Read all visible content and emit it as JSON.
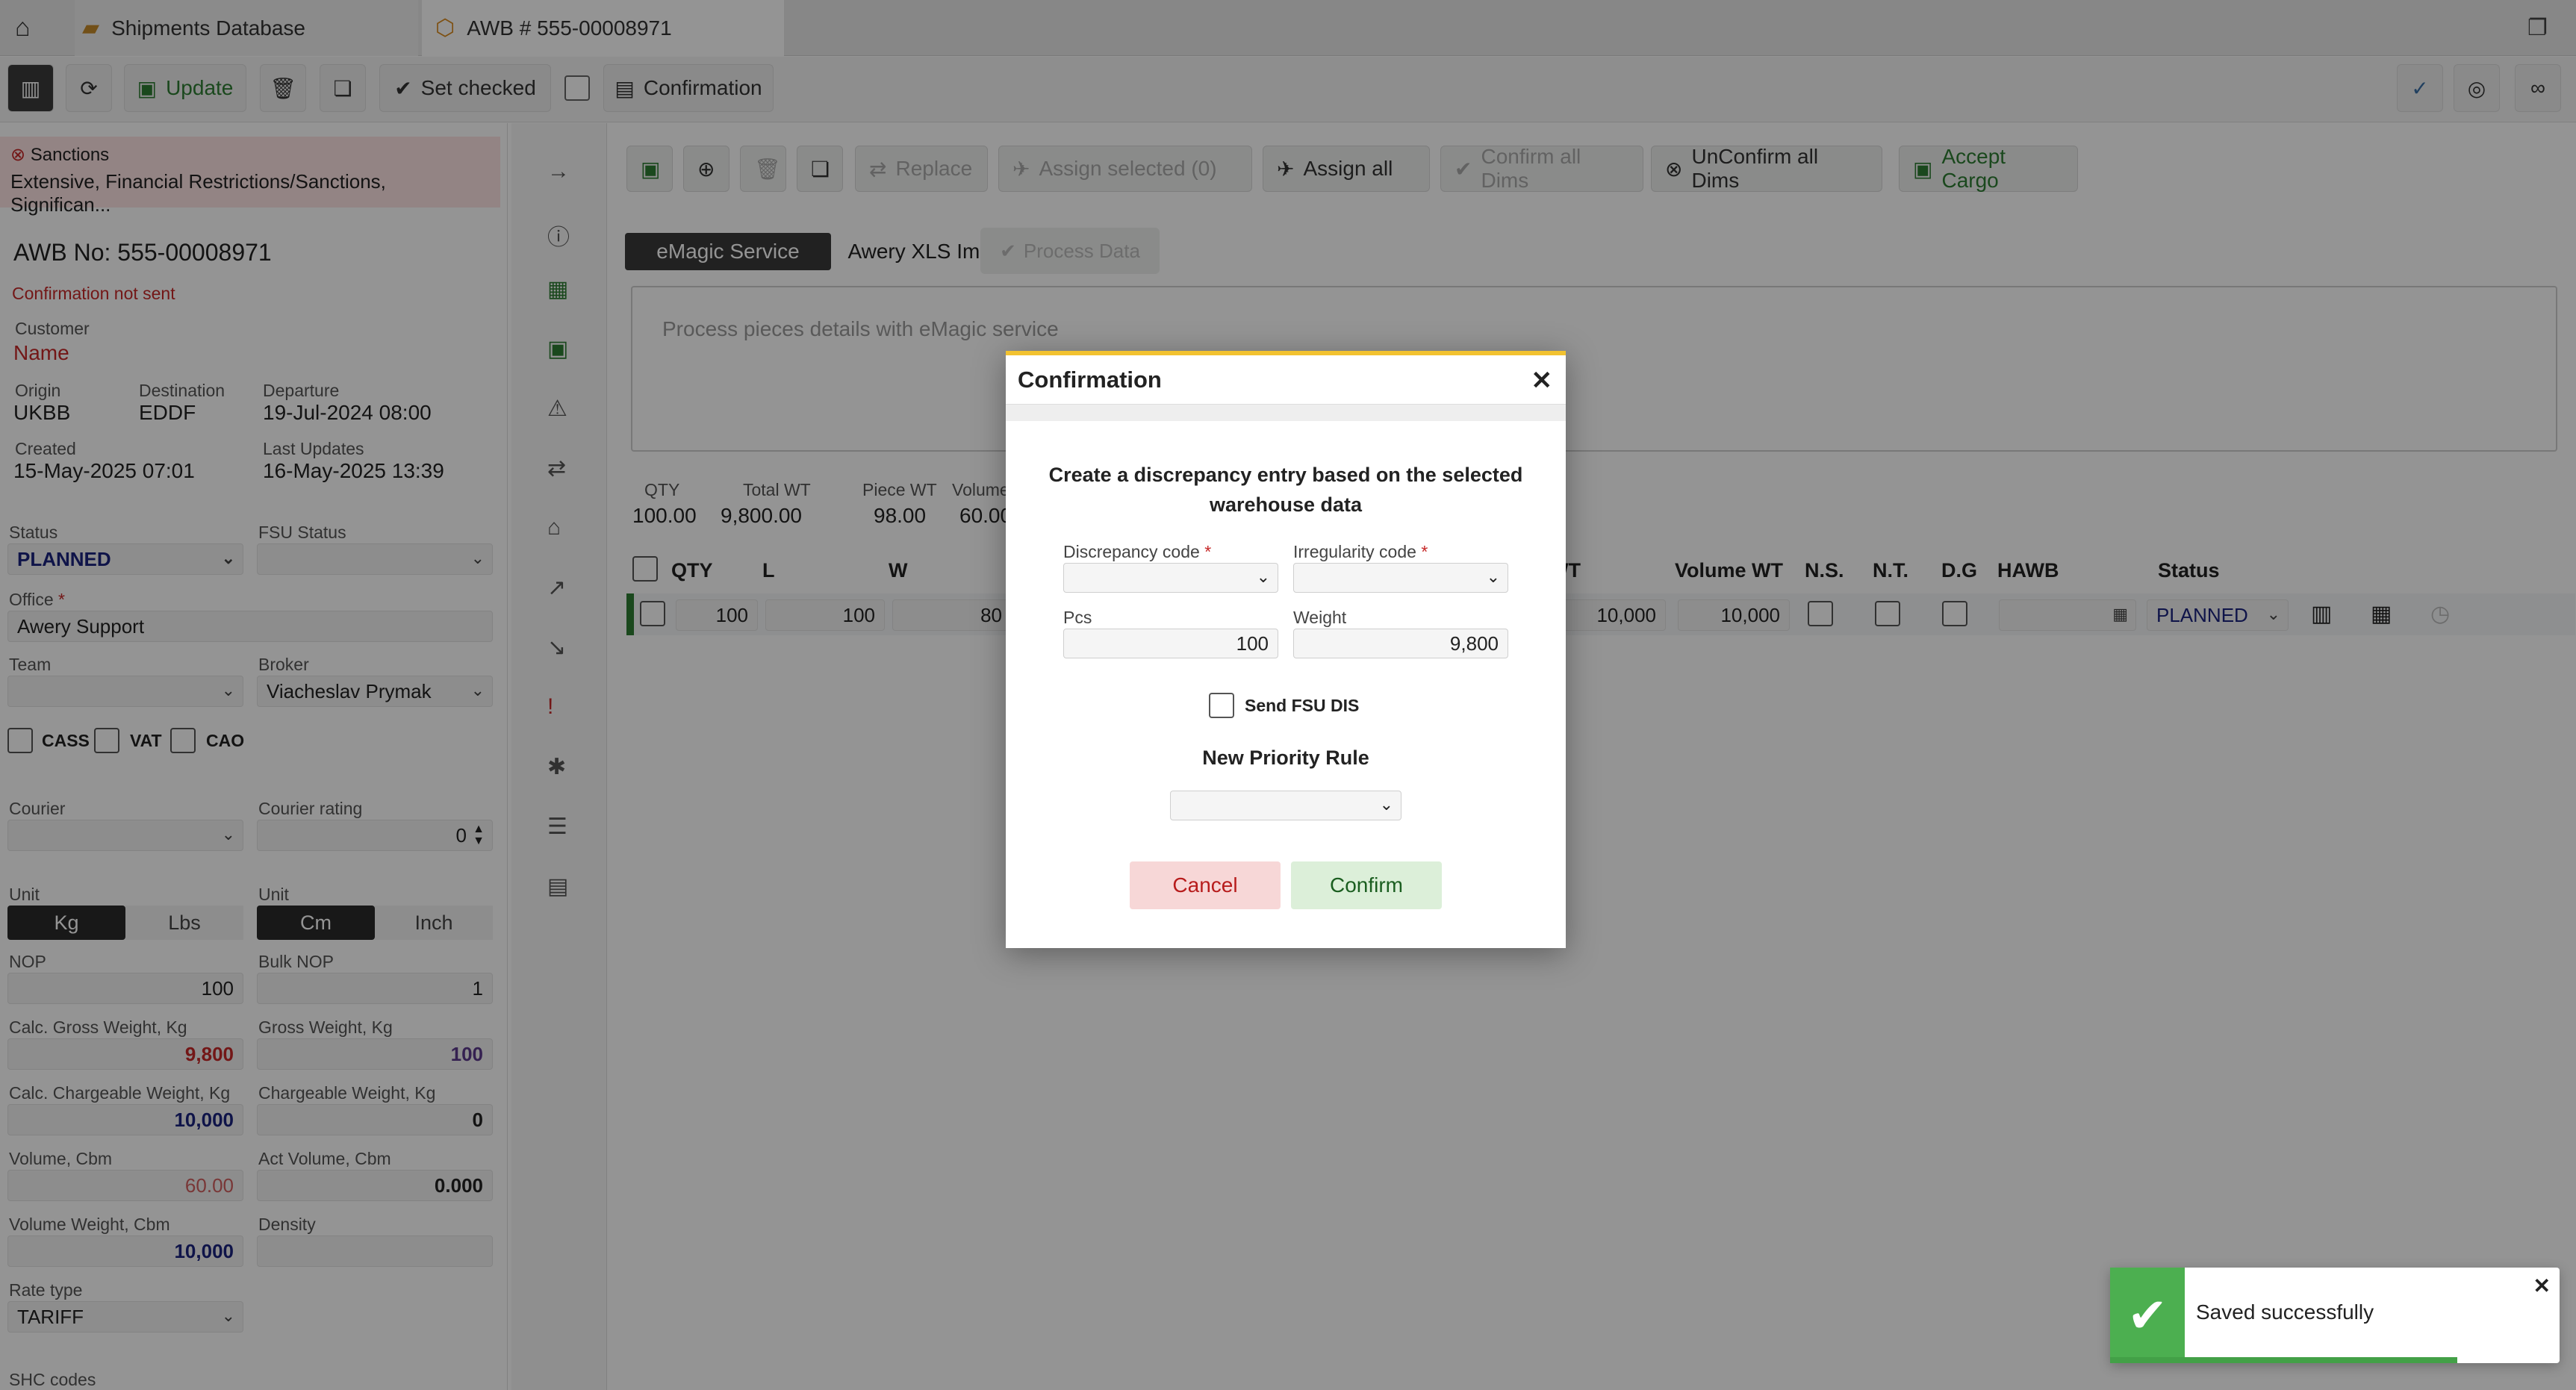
{
  "tabs": [
    {
      "label": "Shipments Database",
      "icon": "folder-icon"
    },
    {
      "label": "AWB # 555-00008971",
      "icon": "hexagon-icon"
    }
  ],
  "toolbar": {
    "update_label": "Update",
    "set_checked_label": "Set checked",
    "confirmation_label": "Confirmation"
  },
  "left": {
    "sanctions_title": "Sanctions",
    "sanctions_text": "Extensive, Financial Restrictions/Sanctions, Significan...",
    "awb_no": "AWB No: 555-00008971",
    "confirmation_status": "Confirmation not sent",
    "customer_label": "Customer",
    "customer_value": "Name",
    "origin_label": "Origin",
    "origin_value": "UKBB",
    "destination_label": "Destination",
    "destination_value": "EDDF",
    "departure_label": "Departure",
    "departure_value": "19-Jul-2024 08:00",
    "created_label": "Created",
    "created_value": "15-May-2025 07:01",
    "last_updates_label": "Last Updates",
    "last_updates_value": "16-May-2025 13:39",
    "status_label": "Status",
    "status_value": "PLANNED",
    "fsu_status_label": "FSU Status",
    "office_label": "Office",
    "office_value": "Awery Support",
    "team_label": "Team",
    "broker_label": "Broker",
    "broker_value": "Viacheslav Prymak",
    "cass_label": "CASS",
    "vat_label": "VAT",
    "cao_label": "CAO",
    "courier_label": "Courier",
    "courier_rating_label": "Courier rating",
    "courier_rating_value": "0",
    "unit_label": "Unit",
    "unit_kg": "Kg",
    "unit_lbs": "Lbs",
    "unit_cm": "Cm",
    "unit_inch": "Inch",
    "nop_label": "NOP",
    "nop_value": "100",
    "bulk_nop_label": "Bulk NOP",
    "bulk_nop_value": "1",
    "calc_gross_label": "Calc. Gross Weight, Kg",
    "calc_gross_value": "9,800",
    "gross_label": "Gross Weight, Kg",
    "gross_value": "100",
    "calc_chargeable_label": "Calc. Chargeable Weight, Kg",
    "calc_chargeable_value": "10,000",
    "chargeable_label": "Chargeable Weight, Kg",
    "chargeable_value": "0",
    "volume_label": "Volume, Cbm",
    "volume_value": "60.00",
    "act_volume_label": "Act Volume, Cbm",
    "act_volume_value": "0.000",
    "volume_weight_label": "Volume Weight, Cbm",
    "volume_weight_value": "10,000",
    "density_label": "Density",
    "rate_type_label": "Rate type",
    "rate_type_value": "TARIFF",
    "shc_label": "SHC codes"
  },
  "main": {
    "replace_label": "Replace",
    "assign_selected_label": "Assign selected (0)",
    "assign_all_label": "Assign all",
    "confirm_all_dims_label": "Confirm all Dims",
    "unconfirm_all_dims_label": "UnConfirm all Dims",
    "accept_cargo_label": "Accept Cargo",
    "sub_tabs": [
      "eMagic Service",
      "Awery XLS Import"
    ],
    "process_data_label": "Process Data",
    "textarea_placeholder": "Process pieces details with eMagic service",
    "summary": [
      {
        "label": "QTY",
        "value": "100.00"
      },
      {
        "label": "Total WT",
        "value": "9,800.00"
      },
      {
        "label": "Piece WT",
        "value": "98.00"
      },
      {
        "label": "Volume",
        "value": "60.00"
      }
    ],
    "grid_headers": {
      "qty": "QTY",
      "l": "L",
      "w": "W",
      "wt": "WT",
      "volume_wt": "Volume WT",
      "ns": "N.S.",
      "nt": "N.T.",
      "dg": "D.G",
      "hawb": "HAWB",
      "status": "Status"
    },
    "grid_row": {
      "qty": "100",
      "l": "100",
      "w": "80",
      "wt": "10,000",
      "volume_wt": "10,000",
      "status": "PLANNED"
    }
  },
  "modal": {
    "title": "Confirmation",
    "message": "Create a discrepancy entry based on the selected warehouse data",
    "discrepancy_code_label": "Discrepancy code",
    "irregularity_code_label": "Irregularity code",
    "pcs_label": "Pcs",
    "pcs_value": "100",
    "weight_label": "Weight",
    "weight_value": "9,800",
    "send_fsu_label": "Send FSU DIS",
    "priority_rule_label": "New Priority Rule",
    "cancel_label": "Cancel",
    "confirm_label": "Confirm"
  },
  "toast": {
    "message": "Saved successfully"
  },
  "colors": {
    "accent_green": "#2e7d32",
    "warning_red": "#c62828",
    "status_blue": "#1a237e",
    "modal_top": "#f2c230"
  }
}
